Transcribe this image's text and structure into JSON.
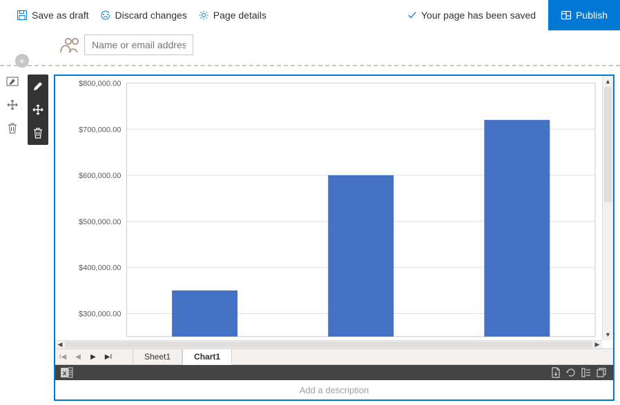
{
  "commandBar": {
    "saveDraft": "Save as draft",
    "discard": "Discard changes",
    "pageDetails": "Page details",
    "statusText": "Your page has been saved",
    "publish": "Publish"
  },
  "author": {
    "placeholder": "Name or email address"
  },
  "webpart": {
    "descriptionPlaceholder": "Add a description",
    "tabs": {
      "sheet1": "Sheet1",
      "chart1": "Chart1"
    }
  },
  "chart_data": {
    "type": "bar",
    "categories": [
      "",
      "",
      ""
    ],
    "values": [
      350000,
      600000,
      720000
    ],
    "title": "",
    "xlabel": "",
    "ylabel": "",
    "ylim": [
      250000,
      800000
    ],
    "yticks": [
      300000,
      400000,
      500000,
      600000,
      700000,
      800000
    ],
    "ytick_labels": [
      "$300,000.00",
      "$400,000.00",
      "$500,000.00",
      "$600,000.00",
      "$700,000.00",
      "$800,000.00"
    ],
    "bar_color": "#4472c4"
  }
}
